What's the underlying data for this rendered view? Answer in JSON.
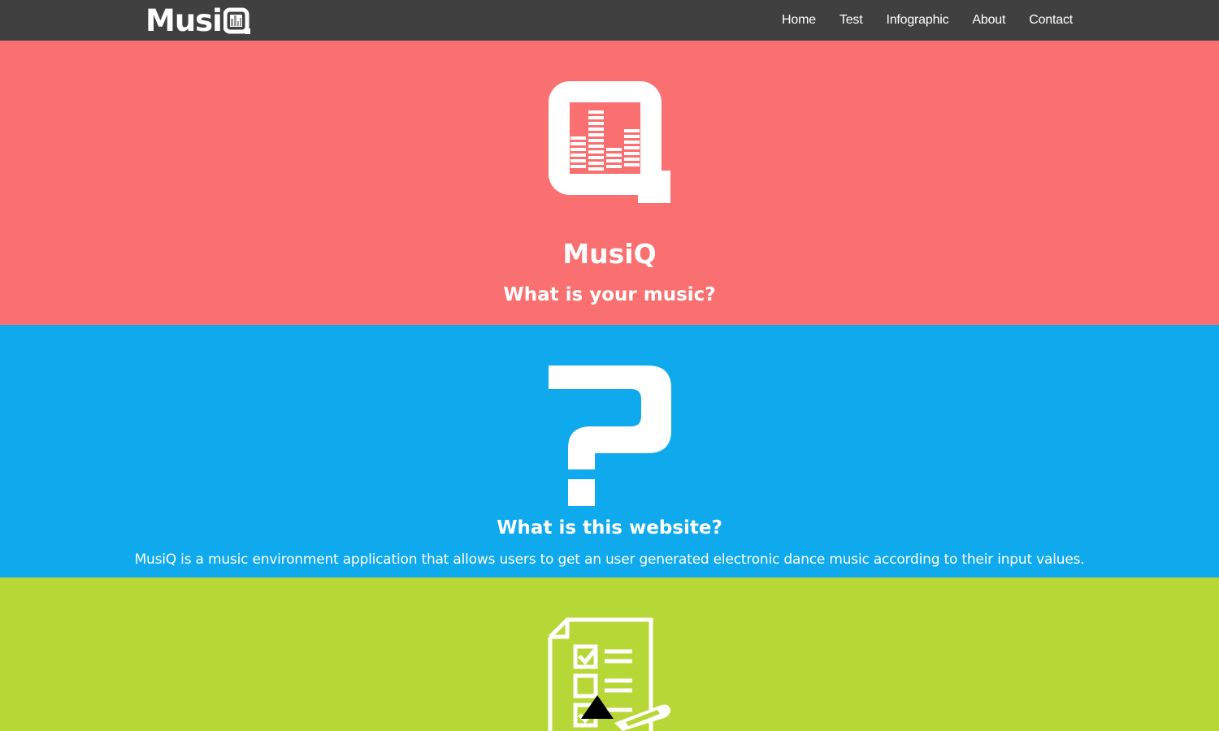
{
  "navbar": {
    "brand": "Musi",
    "links": [
      "Home",
      "Test",
      "Infographic",
      "About",
      "Contact"
    ]
  },
  "hero": {
    "logo_icon": "musiq-equalizer-logo-icon",
    "title": "MusiQ",
    "subtitle": "What is your music?"
  },
  "about": {
    "icon": "question-mark-icon",
    "title": "What is this website?",
    "description": "MusiQ is a music environment application that allows users to get an user generated electronic dance music according to their input values."
  },
  "test": {
    "icon": "checklist-icon"
  },
  "scroll_top": {
    "icon": "triangle-up-icon"
  },
  "colors": {
    "navbar": "#404041",
    "hero": "#fa7070",
    "about": "#0fa9ed",
    "test": "#b6d735"
  }
}
